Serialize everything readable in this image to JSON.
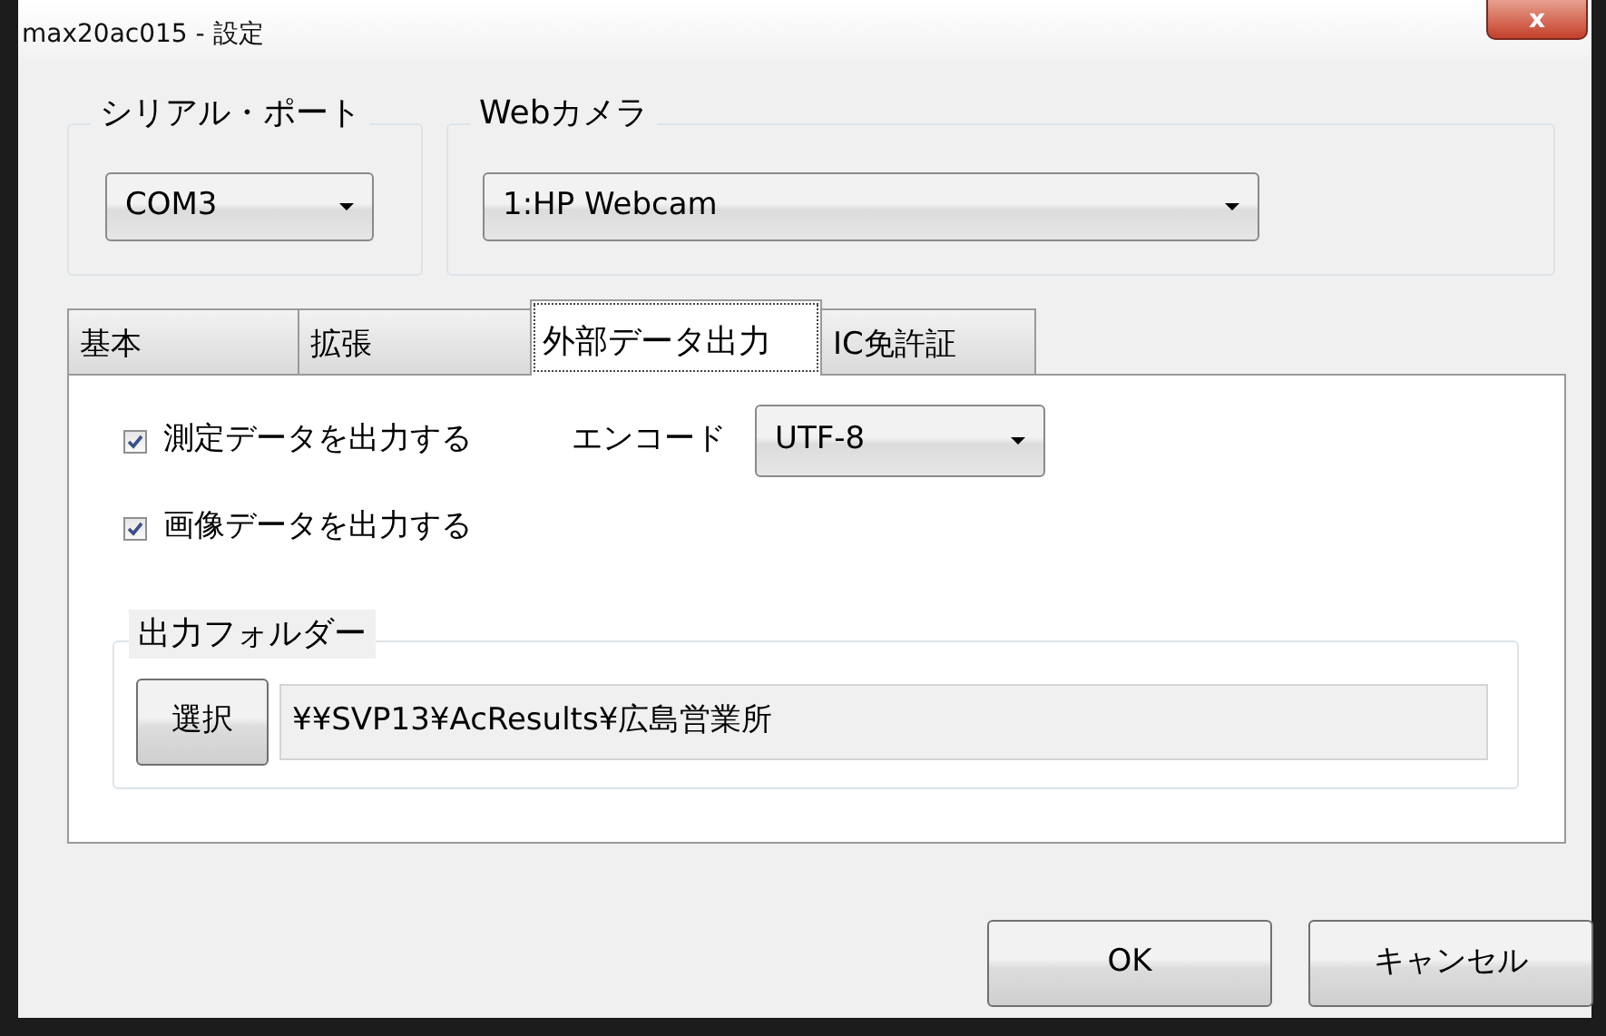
{
  "window": {
    "title": "max20ac015 - 設定",
    "close": "x"
  },
  "serial_port": {
    "label": "シリアル・ポート",
    "value": "COM3"
  },
  "webcam": {
    "label": "Webカメラ",
    "value": "1:HP Webcam"
  },
  "tabs": [
    {
      "label": "基本",
      "selected": false
    },
    {
      "label": "拡張",
      "selected": false
    },
    {
      "label": "外部データ出力",
      "selected": true
    },
    {
      "label": "IC免許証",
      "selected": false
    }
  ],
  "options": [
    {
      "label": "測定データを出力する",
      "checked": true
    },
    {
      "label": "画像データを出力する",
      "checked": true
    }
  ],
  "encoding": {
    "label": "エンコード",
    "value": "UTF-8"
  },
  "output_folder": {
    "label": "出力フォルダー",
    "button": "選択",
    "path": "¥¥SVP13¥AcResults¥広島営業所"
  },
  "buttons": [
    "OK",
    "キャンセル"
  ]
}
